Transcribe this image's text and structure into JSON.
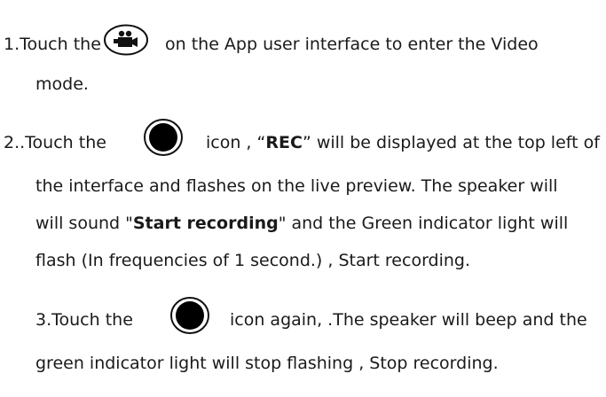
{
  "step1": {
    "a": "1.Touch the",
    "b": "on the App user interface to enter the Video",
    "c": "mode.",
    "icon": "video-camera-icon"
  },
  "step2": {
    "a": "2..Touch the",
    "b": "icon ,",
    "q_open": " “",
    "rec": "REC",
    "q_close": "”",
    "c": " will be displayed at the top left of",
    "d": "the interface and flashes on the live preview. The speaker will",
    "e": "will sound \"",
    "start_rec_bold": "Start recording",
    "f": "\" and the Green indicator light will",
    "g": "flash (In frequencies of 1 second.) , Start recording.",
    "icon": "record-button-icon"
  },
  "step3": {
    "a": "3.Touch the",
    "b": "icon again, .The speaker will beep and the",
    "c": "green indicator light will stop flashing , Stop recording.",
    "icon": "record-button-icon"
  }
}
